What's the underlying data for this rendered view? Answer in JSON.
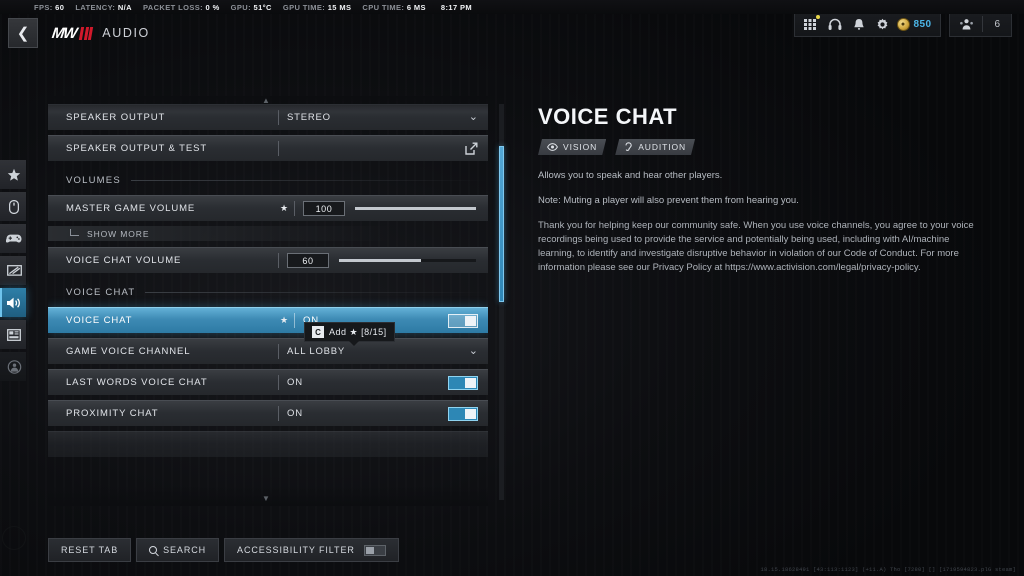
{
  "stats": {
    "items": [
      {
        "label": "FPS:",
        "value": "60"
      },
      {
        "label": "LATENCY:",
        "value": "N/A"
      },
      {
        "label": "PACKET LOSS:",
        "value": "0 %"
      },
      {
        "label": "GPU:",
        "value": "51°C"
      },
      {
        "label": "GPU TIME:",
        "value": "15 MS"
      },
      {
        "label": "CPU TIME:",
        "value": "6 MS"
      }
    ],
    "clock": "8:17 PM"
  },
  "header": {
    "back_icon": "chevron-left-icon",
    "logo_text": "MW",
    "page_title": "AUDIO",
    "icons": [
      {
        "name": "apps-grid-icon",
        "glyph": "☷",
        "badge": true
      },
      {
        "name": "headset-icon",
        "glyph": "♫",
        "badge": false
      },
      {
        "name": "bell-icon",
        "glyph": "▲",
        "badge": false
      },
      {
        "name": "gear-icon",
        "glyph": "⚙",
        "badge": false
      }
    ],
    "currency": {
      "icon": "coin-icon",
      "amount": "850"
    },
    "party": {
      "icon": "squad-icon",
      "count": "6"
    }
  },
  "rail": {
    "items": [
      {
        "name": "sidebar-item-favorites",
        "icon": "star-icon",
        "active": false
      },
      {
        "name": "sidebar-item-mouse-keyboard",
        "icon": "mouse-icon",
        "active": false
      },
      {
        "name": "sidebar-item-controller",
        "icon": "gamepad-icon",
        "active": false
      },
      {
        "name": "sidebar-item-graphics",
        "icon": "display-icon",
        "active": false
      },
      {
        "name": "sidebar-item-audio",
        "icon": "speaker-icon",
        "active": true
      },
      {
        "name": "sidebar-item-interface",
        "icon": "hud-layout-icon",
        "active": false
      },
      {
        "name": "sidebar-item-account",
        "icon": "account-network-icon",
        "active": false
      }
    ]
  },
  "settings": {
    "rows": [
      {
        "type": "dropdown",
        "name": "setting-speaker-output",
        "label": "SPEAKER OUTPUT",
        "value": "STEREO",
        "starred": false,
        "control_icon": "chevron-down-icon"
      },
      {
        "type": "action",
        "name": "setting-speaker-output-test",
        "label": "SPEAKER OUTPUT & TEST",
        "value": "",
        "starred": false,
        "control_icon": "external-link-icon"
      }
    ],
    "section_volumes": "VOLUMES",
    "volume_rows": [
      {
        "type": "slider",
        "name": "setting-master-game-volume",
        "label": "MASTER GAME VOLUME",
        "value": "100",
        "percent": 100,
        "starred": true
      },
      {
        "type": "slider",
        "name": "setting-voice-chat-volume",
        "label": "VOICE CHAT VOLUME",
        "value": "60",
        "percent": 60,
        "starred": false
      }
    ],
    "show_more": "SHOW MORE",
    "section_voice_chat": "VOICE CHAT",
    "voice_rows": [
      {
        "type": "toggle",
        "name": "setting-voice-chat",
        "label": "VOICE CHAT",
        "value": "ON",
        "on": true,
        "starred": true,
        "selected": true
      },
      {
        "type": "dropdown",
        "name": "setting-game-voice-channel",
        "label": "GAME VOICE CHANNEL",
        "value": "ALL LOBBY",
        "starred": false,
        "selected": false,
        "control_icon": "chevron-down-icon"
      },
      {
        "type": "toggle",
        "name": "setting-last-words-voice-chat",
        "label": "LAST WORDS VOICE CHAT",
        "value": "ON",
        "on": true,
        "starred": false,
        "selected": false
      },
      {
        "type": "toggle",
        "name": "setting-proximity-chat",
        "label": "PROXIMITY CHAT",
        "value": "ON",
        "on": true,
        "starred": false,
        "selected": false
      }
    ]
  },
  "keyhint": {
    "key": "C",
    "text": "Add ★ [8/15]"
  },
  "info": {
    "title": "VOICE CHAT",
    "tags": [
      {
        "icon": "eye-icon",
        "label": "VISION"
      },
      {
        "icon": "ear-icon",
        "label": "AUDITION"
      }
    ],
    "description": "Allows you to speak and hear other players.",
    "note": "Note: Muting a player will also prevent them from hearing you.",
    "body": "Thank you for helping keep our community safe. When you use voice channels, you agree to your voice recordings being used to provide the service and potentially being used, including with AI/machine learning, to identify and investigate disruptive behavior in violation of our Code of Conduct.  For more information please see our Privacy Policy at https://www.activision.com/legal/privacy-policy."
  },
  "bottombar": {
    "reset_tab": "RESET TAB",
    "search": "SEARCH",
    "accessibility_filter": "ACCESSIBILITY FILTER",
    "accessibility_on": false
  },
  "build_info": "18.15.18628491 [43:113:1123] (+11.A) Tho [7280] [] [1719594823.plG steam]",
  "colors": {
    "accent_blue": "#2d87b5",
    "selected_row": "#3d8ab4",
    "currency_text": "#4cb6e8",
    "logo_red": "#d1192b"
  }
}
